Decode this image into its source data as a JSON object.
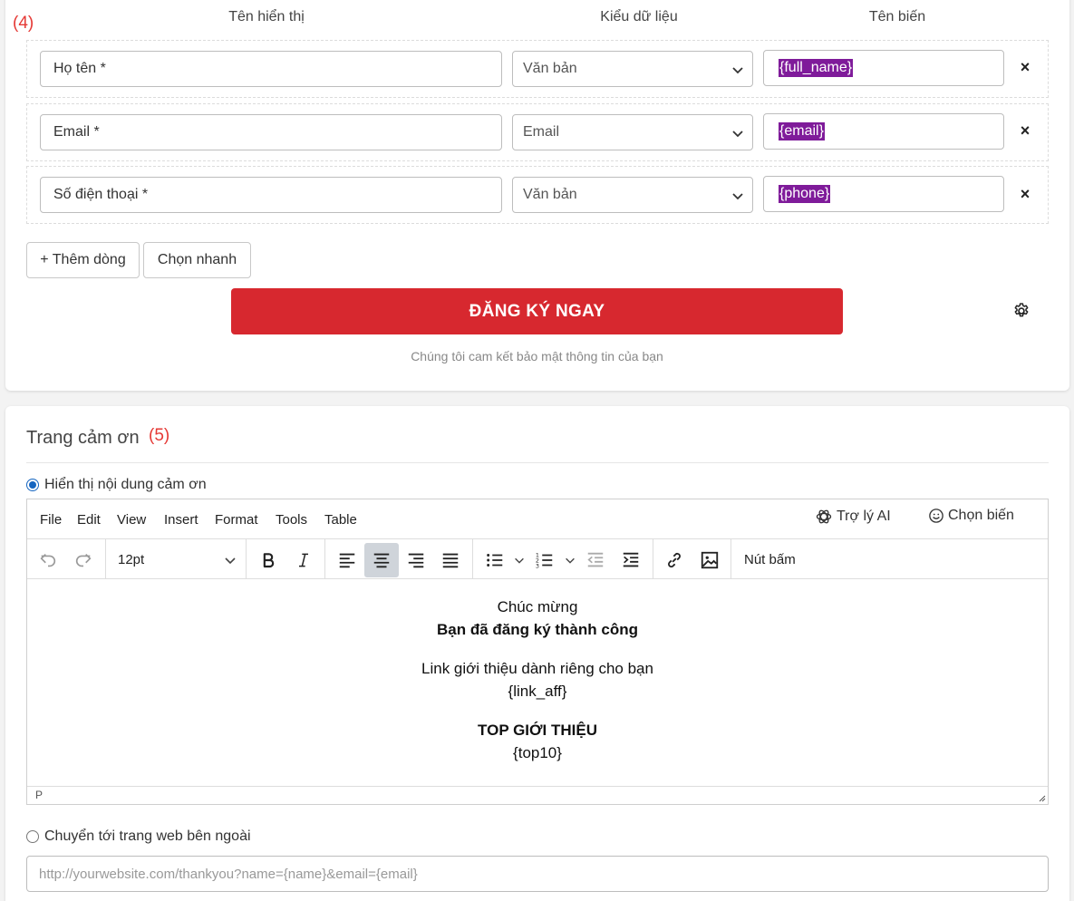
{
  "form_section": {
    "marker": "(4)",
    "columns": {
      "display_name": "Tên hiển thị",
      "data_type": "Kiểu dữ liệu",
      "variable": "Tên biến"
    },
    "rows": [
      {
        "display_name": "Họ tên *",
        "data_type": "Văn bản",
        "variable": "{full_name}",
        "remove": "×"
      },
      {
        "display_name": "Email *",
        "data_type": "Email",
        "variable": "{email}",
        "remove": "×"
      },
      {
        "display_name": "Số điện thoại *",
        "data_type": "Văn bản",
        "variable": "{phone}",
        "remove": "×"
      }
    ],
    "add_row_label": "+ Thêm dòng",
    "quick_pick_label": "Chọn nhanh",
    "submit_label": "ĐĂNG KÝ NGAY",
    "submit_color": "#d7282f",
    "privacy_note": "Chúng tôi cam kết bảo mật thông tin của bạn"
  },
  "thanks_section": {
    "title": "Trang cảm ơn",
    "marker": "(5)",
    "option_show_content": "Hiển thị nội dung cảm ơn",
    "option_show_content_selected": true,
    "option_redirect": "Chuyển tới trang web bên ngoài",
    "option_redirect_selected": false,
    "redirect_placeholder": "http://yourwebsite.com/thankyou?name={name}&email={email}"
  },
  "editor": {
    "menu": [
      "File",
      "Edit",
      "View",
      "Insert",
      "Format",
      "Tools",
      "Table"
    ],
    "ai_assistant": "Trợ lý AI",
    "pick_variable": "Chọn biến",
    "font_size": "12pt",
    "button_label": "Nút bấm",
    "active_align": "center",
    "content": {
      "line1": "Chúc mừng",
      "line2": "Bạn đã đăng ký thành công",
      "line3": "Link giới thiệu dành riêng cho bạn",
      "line4": "{link_aff}",
      "line5": "TOP GIỚI THIỆU",
      "line6": "{top10}"
    },
    "status_path": "P"
  },
  "colors": {
    "variable_highlight": "#7f1b9a",
    "marker": "#e53935",
    "radio_active": "#1565c0"
  }
}
